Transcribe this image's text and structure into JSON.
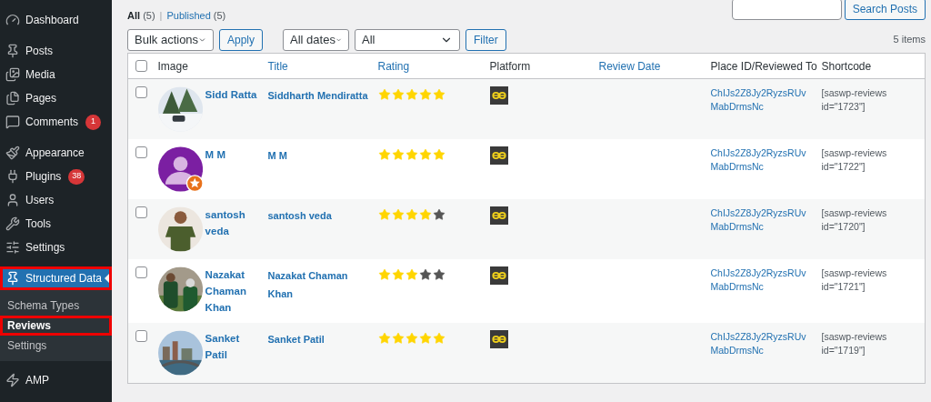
{
  "sidebar": {
    "groups": [
      {
        "items": [
          {
            "label": "Dashboard",
            "selected": false,
            "highlighted": false
          }
        ]
      },
      {
        "items": [
          {
            "label": "Posts",
            "selected": false,
            "highlighted": false
          },
          {
            "label": "Media",
            "selected": false,
            "highlighted": false
          },
          {
            "label": "Pages",
            "selected": false,
            "highlighted": false
          },
          {
            "label": "Comments",
            "badge": "1",
            "selected": false,
            "highlighted": false
          }
        ]
      },
      {
        "items": [
          {
            "label": "Appearance",
            "selected": false,
            "highlighted": false
          },
          {
            "label": "Plugins",
            "badge": "38",
            "selected": false,
            "highlighted": false
          },
          {
            "label": "Users",
            "selected": false,
            "highlighted": false
          },
          {
            "label": "Tools",
            "selected": false,
            "highlighted": false
          },
          {
            "label": "Settings",
            "selected": false,
            "highlighted": false
          }
        ]
      },
      {
        "items": [
          {
            "label": "Structured Data",
            "selected": true,
            "highlighted": true,
            "children": [
              {
                "label": "Schema Types",
                "selected": false,
                "highlighted": false
              },
              {
                "label": "Reviews",
                "selected": true,
                "highlighted": true
              },
              {
                "label": "Settings",
                "selected": false,
                "highlighted": false
              }
            ]
          }
        ]
      },
      {
        "items": [
          {
            "label": "AMP",
            "selected": false,
            "highlighted": false
          }
        ]
      }
    ]
  },
  "views": {
    "separator": "|",
    "items": [
      {
        "label": "All",
        "count": "(5)",
        "selected": true
      },
      {
        "label": "Published",
        "count": "(5)",
        "selected": false
      }
    ]
  },
  "search": {
    "button": "Search Posts"
  },
  "filters": {
    "bulk_actions": "Bulk actions",
    "apply": "Apply",
    "dates": "All dates",
    "type": "All",
    "filter": "Filter",
    "item_count": "5 items"
  },
  "table": {
    "header_checked": false,
    "columns": [
      {
        "label": "Image",
        "sortable": false
      },
      {
        "label": "Title",
        "sortable": true
      },
      {
        "label": "Rating",
        "sortable": true
      },
      {
        "label": "Platform",
        "sortable": false
      },
      {
        "label": "Review Date",
        "sortable": true
      },
      {
        "label": "Place ID/Reviewed To",
        "sortable": false
      },
      {
        "label": "Shortcode",
        "sortable": false
      }
    ],
    "rows": [
      {
        "checked": false,
        "name": "Sidd Ratta",
        "title": "Siddharth Mendiratta",
        "stars": 5,
        "place_id": "ChIJs2Z8Jy2RyzsRUvMabDrmsNc",
        "shortcode": "[saswp-reviews id=\"1723\"]"
      },
      {
        "checked": false,
        "avatar": {
          "kind": "default"
        },
        "name": "M M",
        "title": "M M",
        "stars": 5,
        "place_id": "ChIJs2Z8Jy2RyzsRUvMabDrmsNc",
        "shortcode": "[saswp-reviews id=\"1722\"]"
      },
      {
        "checked": false,
        "name": "santosh veda",
        "title": "santosh veda",
        "stars": 4,
        "place_id": "ChIJs2Z8Jy2RyzsRUvMabDrmsNc",
        "shortcode": "[saswp-reviews id=\"1720\"]"
      },
      {
        "checked": false,
        "name": "Nazakat Chaman Khan",
        "title": "Nazakat Chaman Khan",
        "stars": 3,
        "place_id": "ChIJs2Z8Jy2RyzsRUvMabDrmsNc",
        "shortcode": "[saswp-reviews id=\"1721\"]"
      },
      {
        "checked": false,
        "name": "Sanket Patil",
        "title": "Sanket Patil",
        "stars": 5,
        "place_id": "ChIJs2Z8Jy2RyzsRUvMabDrmsNc",
        "shortcode": "[saswp-reviews id=\"1719\"]"
      }
    ]
  }
}
